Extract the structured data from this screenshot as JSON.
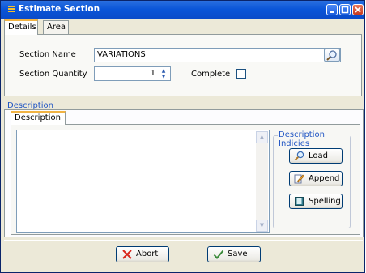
{
  "window": {
    "title": "Estimate Section"
  },
  "tabs": [
    {
      "label": "Details"
    },
    {
      "label": "Area"
    }
  ],
  "form": {
    "section_name_label": "Section Name",
    "section_name_value": "VARIATIONS",
    "section_quantity_label": "Section Quantity",
    "section_quantity_value": "1",
    "complete_label": "Complete",
    "complete_checked": false
  },
  "description": {
    "group_label": "Description",
    "tab_label": "Description",
    "text": "",
    "indicies_title": "Description Indicies",
    "buttons": [
      {
        "label": "Load",
        "icon": "magnifier-icon"
      },
      {
        "label": "Append",
        "icon": "pencil-icon"
      },
      {
        "label": "Spelling",
        "icon": "book-icon"
      }
    ]
  },
  "actions": {
    "abort_label": "Abort",
    "save_label": "Save"
  },
  "colors": {
    "titlebar": "#0a55d8",
    "accent_tab": "#f1b343",
    "group_title": "#2156c4"
  }
}
